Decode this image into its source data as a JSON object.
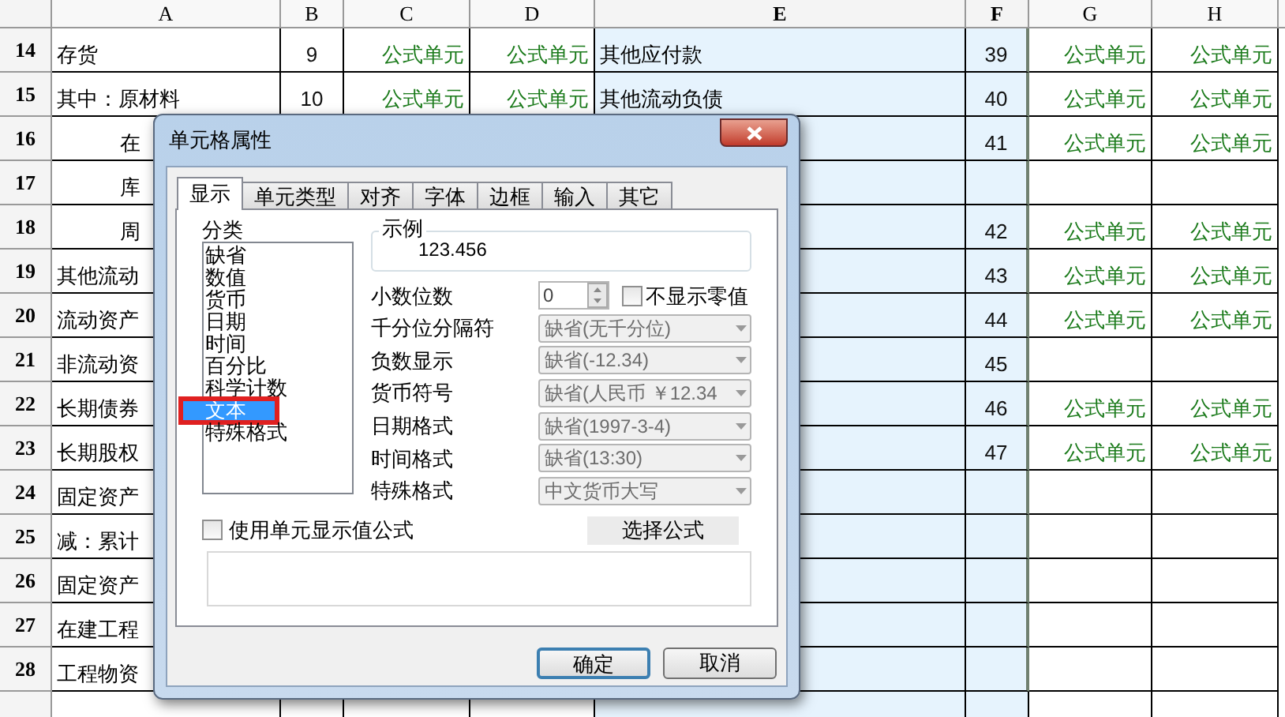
{
  "columns": [
    {
      "label": "A",
      "kind": "text",
      "selected": false
    },
    {
      "label": "B",
      "kind": "number",
      "selected": false
    },
    {
      "label": "C",
      "kind": "formula",
      "selected": false
    },
    {
      "label": "D",
      "kind": "formula",
      "selected": false
    },
    {
      "label": "E",
      "kind": "text",
      "selected": true
    },
    {
      "label": "F",
      "kind": "number",
      "selected": true
    },
    {
      "label": "G",
      "kind": "formula",
      "selected": false
    },
    {
      "label": "H",
      "kind": "formula",
      "selected": false
    }
  ],
  "rows": [
    {
      "number": "14",
      "cells": [
        "存货",
        "9",
        "公式单元",
        "公式单元",
        "其他应付款",
        "39",
        "公式单元",
        "公式单元"
      ]
    },
    {
      "number": "15",
      "cells": [
        "其中：原材料",
        "10",
        "公式单元",
        "公式单元",
        "其他流动负债",
        "40",
        "公式单元",
        "公式单元"
      ]
    },
    {
      "number": "16",
      "indent": true,
      "cells": [
        "在",
        "",
        "",
        "",
        "",
        "41",
        "公式单元",
        "公式单元"
      ]
    },
    {
      "number": "17",
      "indent": true,
      "cells": [
        "库",
        "",
        "",
        "",
        "",
        "",
        "",
        ""
      ]
    },
    {
      "number": "18",
      "indent": true,
      "cells": [
        "周",
        "",
        "",
        "",
        "",
        "42",
        "公式单元",
        "公式单元"
      ]
    },
    {
      "number": "19",
      "cells": [
        "其他流动",
        "",
        "",
        "",
        "",
        "43",
        "公式单元",
        "公式单元"
      ]
    },
    {
      "number": "20",
      "cells": [
        "流动资产",
        "",
        "",
        "",
        "",
        "44",
        "公式单元",
        "公式单元"
      ]
    },
    {
      "number": "21",
      "cells": [
        "非流动资",
        "",
        "",
        "",
        "",
        "45",
        "",
        ""
      ]
    },
    {
      "number": "22",
      "cells": [
        "长期债券",
        "",
        "",
        "",
        "",
        "46",
        "公式单元",
        "公式单元"
      ]
    },
    {
      "number": "23",
      "cells": [
        "长期股权",
        "",
        "",
        "",
        "",
        "47",
        "公式单元",
        "公式单元"
      ]
    },
    {
      "number": "24",
      "cells": [
        "固定资产",
        "",
        "",
        "",
        "",
        "",
        "",
        ""
      ]
    },
    {
      "number": "25",
      "cells": [
        "减：累计",
        "",
        "",
        "",
        "",
        "",
        "",
        ""
      ]
    },
    {
      "number": "26",
      "cells": [
        "固定资产",
        "",
        "",
        "",
        "",
        "",
        "",
        ""
      ]
    },
    {
      "number": "27",
      "cells": [
        "在建工程",
        "",
        "",
        "",
        "",
        "",
        "",
        ""
      ]
    },
    {
      "number": "28",
      "cells": [
        "工程物资",
        "",
        "",
        "",
        "",
        "",
        "",
        ""
      ]
    }
  ],
  "dialog": {
    "title": "单元格属性",
    "tabs": [
      {
        "label": "显示",
        "selected": true
      },
      {
        "label": "单元类型",
        "selected": false
      },
      {
        "label": "对齐",
        "selected": false
      },
      {
        "label": "字体",
        "selected": false
      },
      {
        "label": "边框",
        "selected": false
      },
      {
        "label": "输入",
        "selected": false
      },
      {
        "label": "其它",
        "selected": false
      }
    ],
    "category_label": "分类",
    "categories": [
      {
        "label": "缺省",
        "selected": false,
        "highlighted": false
      },
      {
        "label": "数值",
        "selected": false,
        "highlighted": false
      },
      {
        "label": "货币",
        "selected": false,
        "highlighted": false
      },
      {
        "label": "日期",
        "selected": false,
        "highlighted": false
      },
      {
        "label": "时间",
        "selected": false,
        "highlighted": false
      },
      {
        "label": "百分比",
        "selected": false,
        "highlighted": false
      },
      {
        "label": "科学计数",
        "selected": false,
        "highlighted": false
      },
      {
        "label": "文本",
        "selected": true,
        "highlighted": true
      },
      {
        "label": "特殊格式",
        "selected": false,
        "highlighted": false
      }
    ],
    "sample": {
      "label": "示例",
      "value": "123.456"
    },
    "settings": [
      {
        "kind": "spinner",
        "label": "小数位数",
        "value": "0",
        "checkbox": {
          "label": "不显示零值",
          "checked": false
        }
      },
      {
        "kind": "select",
        "label": "千分位分隔符",
        "value": "缺省(无千分位)",
        "disabled": true
      },
      {
        "kind": "select",
        "label": "负数显示",
        "value": "缺省(-12.34)",
        "disabled": true
      },
      {
        "kind": "select",
        "label": "货币符号",
        "value": "缺省(人民币 ￥12.34",
        "disabled": true
      },
      {
        "kind": "select",
        "label": "日期格式",
        "value": "缺省(1997-3-4)",
        "disabled": true
      },
      {
        "kind": "select",
        "label": "时间格式",
        "value": "缺省(13:30)",
        "disabled": true
      },
      {
        "kind": "select",
        "label": "特殊格式",
        "value": "中文货币大写",
        "disabled": true
      }
    ],
    "use_formula": {
      "label": "使用单元显示值公式",
      "checked": false
    },
    "choose_formula_button": "选择公式",
    "buttons": [
      {
        "label": "确定",
        "default": true
      },
      {
        "label": "取消",
        "default": false
      }
    ]
  }
}
